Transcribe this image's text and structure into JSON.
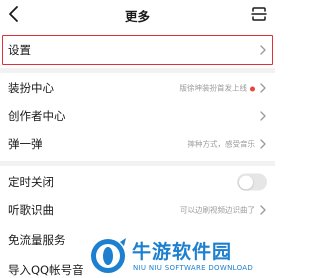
{
  "header": {
    "title": "更多",
    "back_icon": "chevron-left-icon",
    "scan_icon": "scan-icon"
  },
  "settings_row": {
    "label": "设置"
  },
  "items": [
    {
      "label": "装扮中心",
      "sub": "版徐坤装扮首发上线",
      "has_dot": true
    },
    {
      "label": "创作者中心",
      "sub": ""
    },
    {
      "label": "弹一弹",
      "sub": "摔种方式，感受音乐"
    },
    {
      "label": "定时关闭",
      "toggle_on": false
    },
    {
      "label": "听歌识曲",
      "sub": "可以边刷视频边识曲了"
    },
    {
      "label": "免流量服务"
    },
    {
      "label": "导入QQ帐号音"
    }
  ],
  "watermark": {
    "text": "牛游软件园",
    "sub": "NIU NIU SOFTWARE DOWNLOAD"
  },
  "colors": {
    "highlight": "#e0313a",
    "watermark": "#1c7fcf",
    "dot": "#e8453c"
  }
}
